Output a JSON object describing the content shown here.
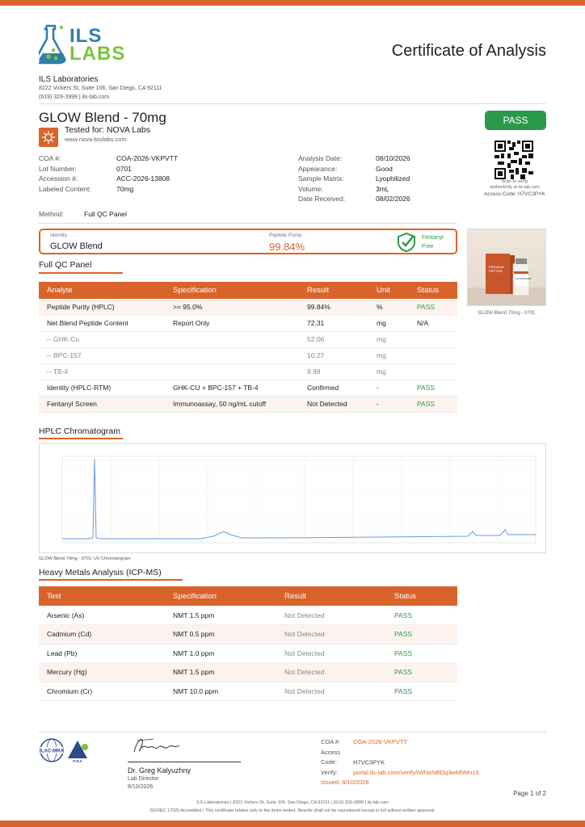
{
  "header": {
    "logo_text_1": "ILS",
    "logo_text_2": "LABS",
    "doc_title": "Certificate of Analysis"
  },
  "lab": {
    "name": "ILS Laboratories",
    "address": "8222 Vickers St, Suite 106, San Diego, CA 92111",
    "contact": "(619) 329-3999  |  ils-lab.com"
  },
  "product": {
    "name": "GLOW Blend - 70mg",
    "tested_for": "Tested for: NOVA Labs",
    "client_url": "www.nova-biolabs.com",
    "result_badge": "PASS"
  },
  "qr": {
    "caption_1": "Scan to verify",
    "caption_2": "authenticity at ils-lab.com",
    "access_code": "Access Code: H7VC3PYK"
  },
  "meta_left": [
    {
      "label": "COA #:",
      "value": "COA-2026-VKPVTT"
    },
    {
      "label": "Lot Number:",
      "value": "0701"
    },
    {
      "label": "Accession #:",
      "value": "ACC-2026-13808"
    },
    {
      "label": "Labeled Content:",
      "value": "70mg"
    }
  ],
  "meta_right": [
    {
      "label": "Analysis Date:",
      "value": "08/10/2026"
    },
    {
      "label": "Appearance:",
      "value": "Good"
    },
    {
      "label": "Sample Matrix:",
      "value": "Lyophilized"
    },
    {
      "label": "Volume:",
      "value": "3mL"
    },
    {
      "label": "Date Received:",
      "value": "08/02/2026"
    }
  ],
  "method": {
    "label": "Method:",
    "value": "Full QC Panel"
  },
  "summary": {
    "identity_label": "Identity",
    "identity_value": "GLOW Blend",
    "purity_label": "Peptide Purity",
    "purity_value": "99.84%",
    "fentanyl_1": "Fentanyl",
    "fentanyl_2": "Free"
  },
  "photo": {
    "caption": "GLOW Blend 70mg - 0701",
    "box_label": "PREMIUM\nPEPTIDE",
    "vial_label": "GLOW BLEND"
  },
  "qc": {
    "title": "Full QC Panel",
    "headers": [
      "Analyte",
      "Specification",
      "Result",
      "Unit",
      "Status"
    ],
    "rows": [
      [
        "Peptide Purity (HPLC)",
        ">= 95.0%",
        "99.84%",
        "%",
        "PASS"
      ],
      [
        "Net Blend Peptide Content",
        "Report Only",
        "72.31",
        "mg",
        "N/A"
      ],
      [
        "-- GHK-Cu",
        "",
        "52.06",
        "mg",
        ""
      ],
      [
        "-- BPC-157",
        "",
        "10.27",
        "mg",
        ""
      ],
      [
        "-- TB-4",
        "",
        "9.98",
        "mg",
        ""
      ],
      [
        "Identity (HPLC-RTM)",
        "GHK-CU + BPC-157 + TB-4",
        "Confirmed",
        "-",
        "PASS"
      ],
      [
        "Fentanyl Screen",
        "Immunoassay, 50 ng/mL cutoff",
        "Not Detected",
        "-",
        "PASS"
      ]
    ]
  },
  "hplc": {
    "title": "HPLC Chromatogram",
    "caption": "GLOW Blend 70mg - 0701: UV Chromatogram"
  },
  "metals": {
    "title": "Heavy Metals Analysis (ICP-MS)",
    "headers": [
      "Test",
      "Specification",
      "Result",
      "Status"
    ],
    "rows": [
      [
        "Arsenic (As)",
        "NMT 1.5 ppm",
        "Not Detected",
        "PASS"
      ],
      [
        "Cadmium (Cd)",
        "NMT 0.5 ppm",
        "Not Detected",
        "PASS"
      ],
      [
        "Lead (Pb)",
        "NMT 1.0 ppm",
        "Not Detected",
        "PASS"
      ],
      [
        "Mercury (Hg)",
        "NMT 1.5 ppm",
        "Not Detected",
        "PASS"
      ],
      [
        "Chromium (Cr)",
        "NMT 10.0 ppm",
        "Not Detected",
        "PASS"
      ]
    ]
  },
  "footer": {
    "logo_1": "ILAC-MRA",
    "logo_2": "PJLA",
    "signer": "Dr. Greg Kalyuzhny",
    "signer_title": "Lab Director",
    "signer_date": "8/10/2026",
    "coa_label": "COA #:",
    "coa_value": "COA-2026-VKPVTT",
    "access_label": "Access Code:",
    "access_value": "H7VC3PYK",
    "verify_label": "Verify:",
    "verify_value": "portal.ils-lab.com/verify/IWNxNBDq3wM5Mn15",
    "issued": "Issued: 8/10/2026",
    "page": "Page 1 of 2",
    "line1": "ILS Laboratories  |  8222 Vickers St, Suite 106, San Diego, CA 92111  |  (619) 329-3999  |  ils-lab.com",
    "line2": "ISO/IEC 17025 Accredited  |  This certificate relates only to the items tested. Results shall not be reproduced except in full without written approval."
  },
  "colors": {
    "accent": "#d9642b",
    "pass": "#2a9a4a",
    "brand": "#2f7fa6"
  }
}
